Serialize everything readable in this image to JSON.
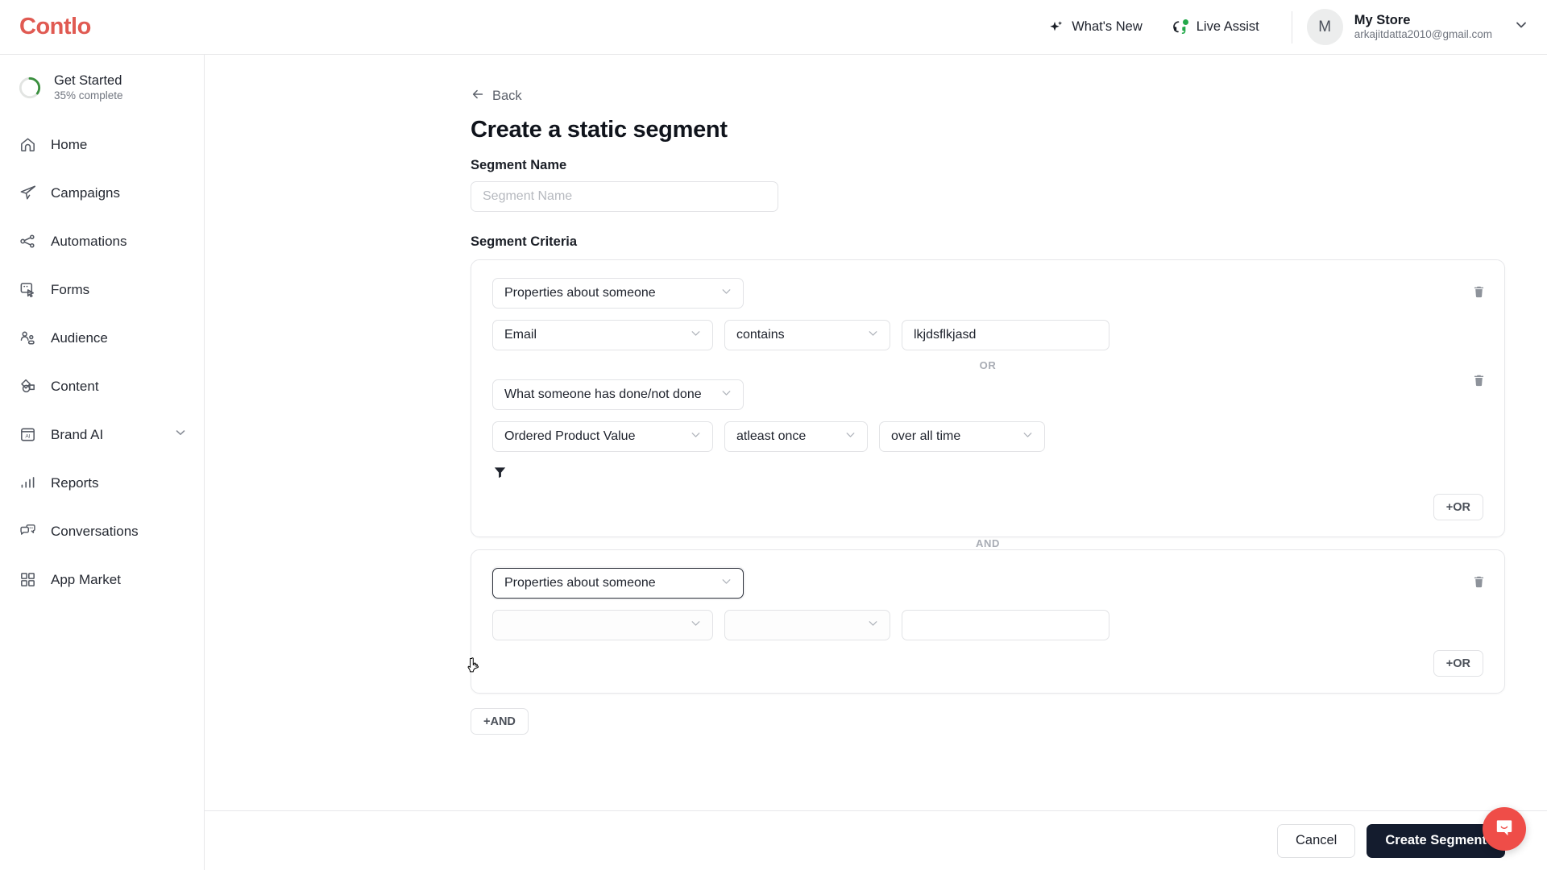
{
  "brand": {
    "name": "Contlo",
    "color": "#e05a52"
  },
  "topbar": {
    "whats_new": "What's New",
    "live_assist": "Live Assist",
    "account": {
      "initial": "M",
      "store": "My Store",
      "email": "arkajitdatta2010@gmail.com"
    },
    "icons": {
      "sparkle": "sparkle-icon",
      "headset": "headset-icon",
      "chevron": "chevron-down-icon"
    }
  },
  "sidebar": {
    "get_started": {
      "title": "Get Started",
      "subtitle": "35% complete",
      "percent": 35,
      "ring_color": "#3a8f3e"
    },
    "items": [
      {
        "label": "Home",
        "icon": "home-icon",
        "expandable": false
      },
      {
        "label": "Campaigns",
        "icon": "paper-plane-icon",
        "expandable": false
      },
      {
        "label": "Automations",
        "icon": "nodes-icon",
        "expandable": false
      },
      {
        "label": "Forms",
        "icon": "form-cursor-icon",
        "expandable": false
      },
      {
        "label": "Audience",
        "icon": "people-icon",
        "expandable": false
      },
      {
        "label": "Content",
        "icon": "shapes-icon",
        "expandable": false
      },
      {
        "label": "Brand AI",
        "icon": "ai-box-icon",
        "expandable": true
      },
      {
        "label": "Reports",
        "icon": "bar-chart-icon",
        "expandable": false
      },
      {
        "label": "Conversations",
        "icon": "chat-bubbles-icon",
        "expandable": false
      },
      {
        "label": "App Market",
        "icon": "grid-squares-icon",
        "expandable": false
      }
    ]
  },
  "main": {
    "back_label": "Back",
    "page_title": "Create a static segment",
    "segment_name": {
      "label": "Segment Name",
      "placeholder": "Segment Name",
      "value": ""
    },
    "criteria_label": "Segment Criteria",
    "or_separator": "OR",
    "and_separator": "AND",
    "add_or_label": "+OR",
    "add_and_label": "+AND",
    "groups": [
      {
        "type_select": {
          "value": "Properties about someone",
          "focused": false
        },
        "conditions": [
          {
            "field": {
              "value": "Email"
            },
            "operator": {
              "value": "contains"
            },
            "value_input": {
              "value": "lkjdsflkjasd",
              "placeholder": ""
            }
          },
          {
            "type_select": {
              "value": "What someone has done/not done"
            },
            "field": {
              "value": "Ordered Product Value"
            },
            "operator": {
              "value": "atleast once"
            },
            "timeframe": {
              "value": "over all time"
            },
            "has_filter_icon": true
          }
        ]
      },
      {
        "type_select": {
          "value": "Properties about someone",
          "focused": true
        },
        "conditions": [
          {
            "field": {
              "value": ""
            },
            "operator": {
              "value": ""
            },
            "value_input": {
              "value": "",
              "placeholder": ""
            }
          }
        ]
      }
    ]
  },
  "footer": {
    "cancel_label": "Cancel",
    "create_label": "Create Segment",
    "primary_color": "#141c2e"
  },
  "chat_widget": {
    "icon": "chat-bubble-icon",
    "color": "#ef4d48"
  }
}
